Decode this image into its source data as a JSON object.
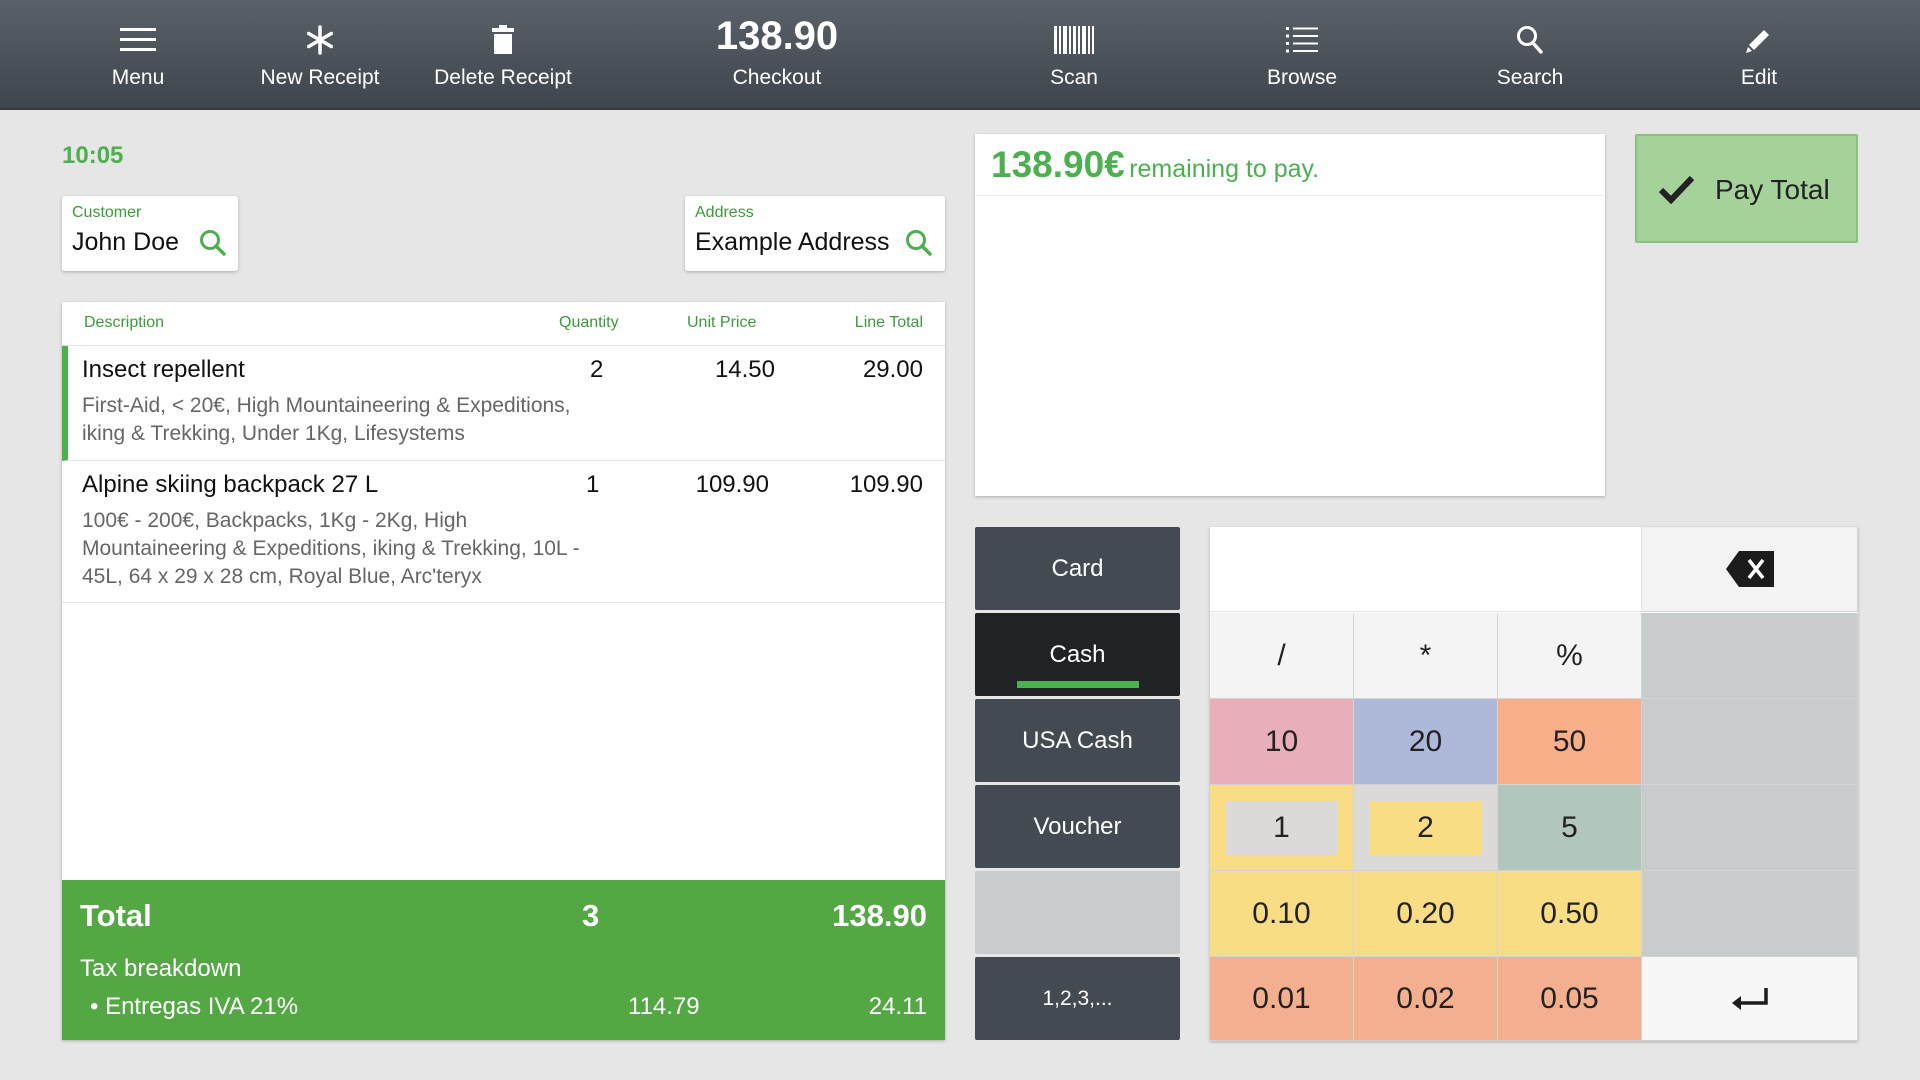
{
  "topbar": {
    "menu": "Menu",
    "new_receipt": "New Receipt",
    "delete_receipt": "Delete Receipt",
    "checkout_amount": "138.90",
    "checkout": "Checkout",
    "scan": "Scan",
    "browse": "Browse",
    "search": "Search",
    "edit": "Edit"
  },
  "clock": "10:05",
  "customer": {
    "label": "Customer",
    "value": "John Doe"
  },
  "address": {
    "label": "Address",
    "value": "Example Address"
  },
  "receipt": {
    "headers": {
      "description": "Description",
      "quantity": "Quantity",
      "unit_price": "Unit Price",
      "line_total": "Line Total"
    },
    "lines": [
      {
        "title": "Insect repellent",
        "qty": "2",
        "unit": "14.50",
        "total": "29.00",
        "desc": "First-Aid, < 20€, High Mountaineering & Expeditions, iking & Trekking, Under 1Kg, Lifesystems"
      },
      {
        "title": "Alpine skiing backpack 27 L",
        "qty": "1",
        "unit": "109.90",
        "total": "109.90",
        "desc": "100€ - 200€, Backpacks, 1Kg - 2Kg, High Mountaineering & Expeditions, iking & Trekking, 10L - 45L, 64 x 29 x 28 cm, Royal Blue, Arc'teryx"
      }
    ],
    "total_label": "Total",
    "total_qty": "3",
    "total_amount": "138.90",
    "tax_title": "Tax breakdown",
    "tax_name": "Entregas IVA 21%",
    "tax_base": "114.79",
    "tax_amount": "24.11"
  },
  "payment": {
    "remaining_amount": "138.90€",
    "remaining_text": "remaining to pay.",
    "pay_total": "Pay Total",
    "methods": {
      "card": "Card",
      "cash": "Cash",
      "usa_cash": "USA Cash",
      "voucher": "Voucher",
      "numbers": "1,2,3,..."
    },
    "active_method": "Cash"
  },
  "keypad": {
    "ops": [
      "/",
      "*",
      "%"
    ],
    "row_bills": [
      "10",
      "20",
      "50"
    ],
    "row_units": [
      "1",
      "2",
      "5"
    ],
    "row_tenths": [
      "0.10",
      "0.20",
      "0.50"
    ],
    "row_cents": [
      "0.01",
      "0.02",
      "0.05"
    ]
  },
  "colors": {
    "accent_green": "#4caf50",
    "topbar": "#4a5058",
    "key_pink": "#e8afbb",
    "key_blue": "#aeb8d8",
    "key_orange": "#f8ae88",
    "key_yellow": "#f8dd85",
    "key_grey_green": "#b1c7bb",
    "key_salmon": "#f4b08e"
  },
  "icons": [
    "menu-icon",
    "asterisk-icon",
    "trash-icon",
    "barcode-icon",
    "list-icon",
    "search-icon",
    "pencil-icon",
    "check-icon",
    "backspace-icon",
    "enter-icon"
  ]
}
